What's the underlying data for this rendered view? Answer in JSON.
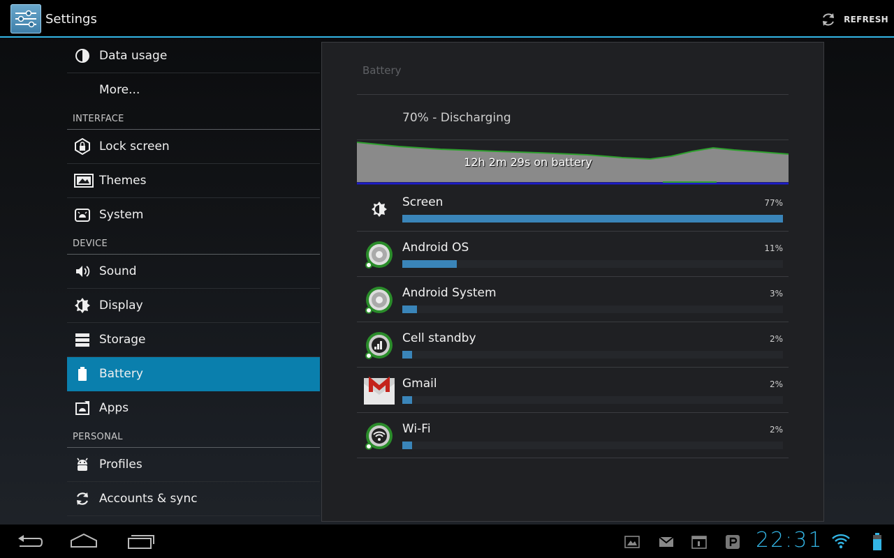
{
  "app": {
    "title": "Settings",
    "refresh_label": "REFRESH"
  },
  "sidebar": {
    "items_top": [
      {
        "label": "Data usage",
        "icon": "pie-chart-icon"
      },
      {
        "label": "More...",
        "icon": ""
      }
    ],
    "sections": [
      {
        "title": "INTERFACE",
        "items": [
          {
            "label": "Lock screen",
            "icon": "lock-icon"
          },
          {
            "label": "Themes",
            "icon": "image-icon"
          },
          {
            "label": "System",
            "icon": "android-icon"
          }
        ]
      },
      {
        "title": "DEVICE",
        "items": [
          {
            "label": "Sound",
            "icon": "speaker-icon"
          },
          {
            "label": "Display",
            "icon": "brightness-icon"
          },
          {
            "label": "Storage",
            "icon": "storage-icon"
          },
          {
            "label": "Battery",
            "icon": "battery-icon",
            "active": true
          },
          {
            "label": "Apps",
            "icon": "apps-icon"
          }
        ]
      },
      {
        "title": "PERSONAL",
        "items": [
          {
            "label": "Profiles",
            "icon": "profile-icon"
          },
          {
            "label": "Accounts & sync",
            "icon": "sync-icon"
          }
        ]
      }
    ]
  },
  "battery": {
    "title": "Battery",
    "status": "70% - Discharging",
    "graph_label": "12h 2m 29s on battery",
    "usage": [
      {
        "name": "Screen",
        "percent_label": "77%",
        "percent": 77,
        "icon": "brightness-icon"
      },
      {
        "name": "Android OS",
        "percent_label": "11%",
        "percent": 11,
        "icon": "android-os-icon"
      },
      {
        "name": "Android System",
        "percent_label": "3%",
        "percent": 3,
        "icon": "android-system-icon"
      },
      {
        "name": "Cell standby",
        "percent_label": "2%",
        "percent": 2,
        "icon": "signal-icon"
      },
      {
        "name": "Gmail",
        "percent_label": "2%",
        "percent": 2,
        "icon": "gmail-icon"
      },
      {
        "name": "Wi-Fi",
        "percent_label": "2%",
        "percent": 2,
        "icon": "wifi-icon"
      }
    ]
  },
  "navbar": {
    "clock": "22:31",
    "accent": "#33b5e5"
  }
}
